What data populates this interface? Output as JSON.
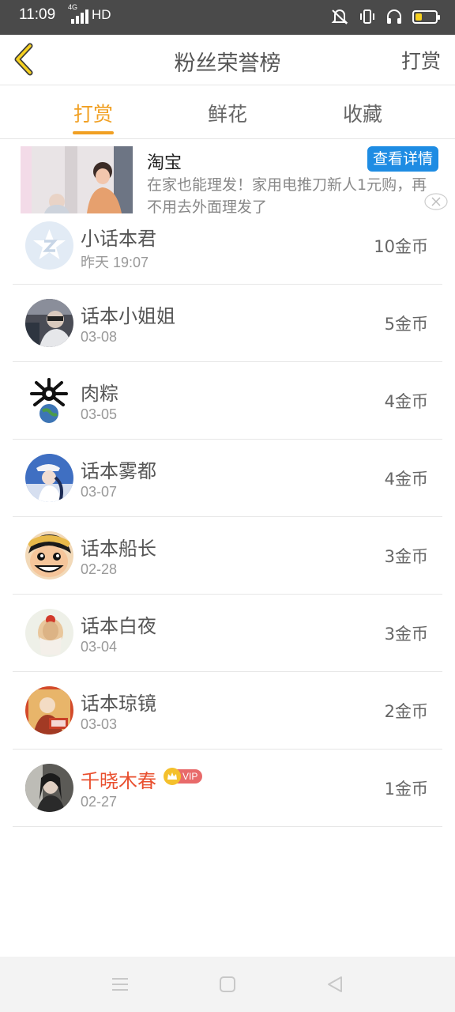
{
  "status_bar": {
    "time": "11:09",
    "network": "4G",
    "quality": "HD"
  },
  "header": {
    "title": "粉丝荣誉榜",
    "action": "打赏",
    "back_icon": "chevron-left-icon"
  },
  "tabs": [
    {
      "label": "打赏",
      "active": true
    },
    {
      "label": "鲜花",
      "active": false
    },
    {
      "label": "收藏",
      "active": false
    }
  ],
  "ad": {
    "title": "淘宝",
    "button": "查看详情",
    "description": "在家也能理发！家用电推刀新人1元购，再不用去外面理发了"
  },
  "ranking": [
    {
      "name": "小话本君",
      "date": "昨天 19:07",
      "coins": "10金币"
    },
    {
      "name": "话本小姐姐",
      "date": "03-08",
      "coins": "5金币"
    },
    {
      "name": "肉粽",
      "date": "03-05",
      "coins": "4金币"
    },
    {
      "name": "话本雾都",
      "date": "03-07",
      "coins": "4金币"
    },
    {
      "name": "话本船长",
      "date": "02-28",
      "coins": "3金币"
    },
    {
      "name": "话本白夜",
      "date": "03-04",
      "coins": "3金币"
    },
    {
      "name": "话本琼镜",
      "date": "03-03",
      "coins": "2金币"
    },
    {
      "name": "千晓木春",
      "date": "02-27",
      "coins": "1金币",
      "vip": "VIP"
    }
  ],
  "colors": {
    "accent": "#f1a023",
    "link_blue": "#1e8ce3",
    "vip_red": "#e94f2e"
  }
}
